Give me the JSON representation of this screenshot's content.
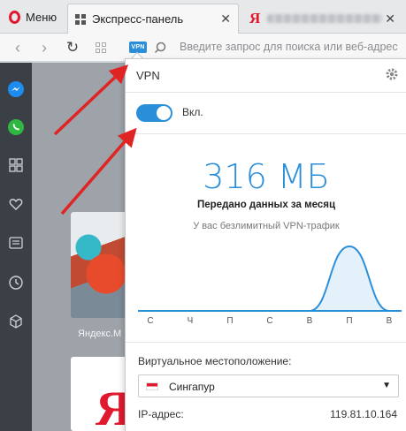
{
  "browser": {
    "menu_label": "Меню",
    "active_tab_title": "Экспресс-панель",
    "tab_close_glyph": "✕",
    "second_tab_icon_glyph": "Я",
    "address_placeholder": "Введите запрос для поиска или веб-адрес",
    "vpn_badge": "VPN",
    "nav_back_glyph": "‹",
    "nav_forward_glyph": "›",
    "reload_glyph": "↻"
  },
  "sidebar": {
    "items": [
      {
        "icon": "messenger-icon"
      },
      {
        "icon": "whatsapp-icon"
      },
      {
        "icon": "speed-dial-icon"
      },
      {
        "icon": "heart-icon"
      },
      {
        "icon": "news-icon"
      },
      {
        "icon": "history-icon"
      },
      {
        "icon": "extensions-icon"
      }
    ]
  },
  "content": {
    "tile1_label": "Яндекс.М",
    "tile2_glyph": "Я"
  },
  "vpn_popup": {
    "title": "VPN",
    "toggle_label": "Вкл.",
    "toggle_on": true,
    "traffic_amount": "316 МБ",
    "traffic_caption": "Передано данных за месяц",
    "unlimited_note": "У вас безлимитный VPN-трафик",
    "location_label": "Виртуальное местоположение:",
    "location_value": "Сингапур",
    "ip_label": "IP-адрес:",
    "ip_value": "119.81.10.164",
    "select_caret": "▼"
  },
  "chart_data": {
    "type": "area",
    "categories": [
      "С",
      "Ч",
      "П",
      "С",
      "В",
      "П",
      "В"
    ],
    "values": [
      0,
      0,
      0,
      0,
      0,
      1,
      0
    ],
    "grid": false
  },
  "colors": {
    "accent": "#2a8ed9",
    "opera_red": "#e0192e",
    "sidebar_bg": "#3b4046",
    "arrow_red": "#e02424"
  }
}
